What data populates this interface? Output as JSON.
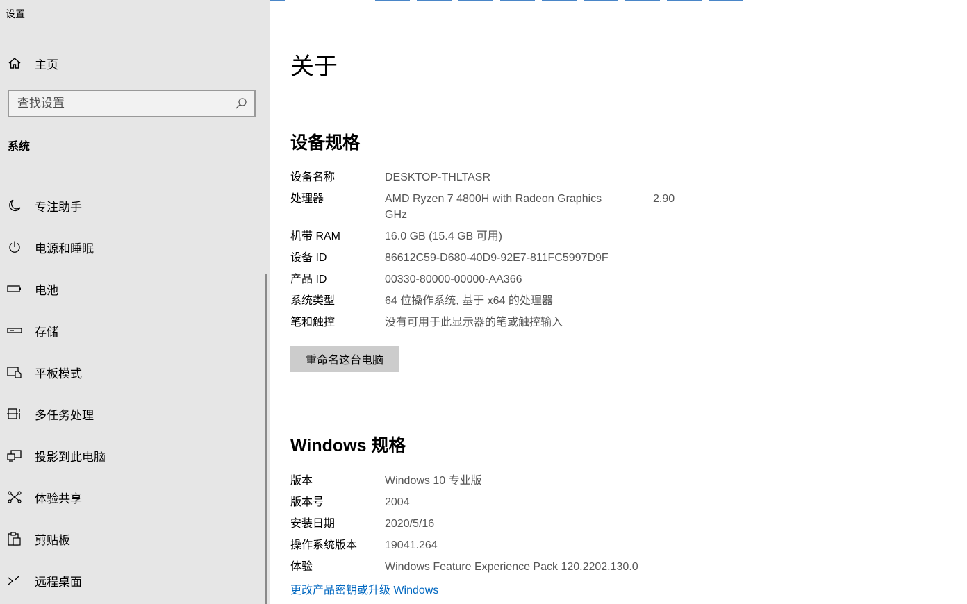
{
  "window": {
    "title": "设置"
  },
  "sidebar": {
    "home_label": "主页",
    "search_placeholder": "查找设置",
    "section_title": "系统",
    "items": [
      {
        "label": "专注助手",
        "icon": "moon-icon"
      },
      {
        "label": "电源和睡眠",
        "icon": "power-icon"
      },
      {
        "label": "电池",
        "icon": "battery-icon"
      },
      {
        "label": "存储",
        "icon": "storage-icon"
      },
      {
        "label": "平板模式",
        "icon": "tablet-mode-icon"
      },
      {
        "label": "多任务处理",
        "icon": "multitasking-icon"
      },
      {
        "label": "投影到此电脑",
        "icon": "project-icon"
      },
      {
        "label": "体验共享",
        "icon": "shared-experience-icon"
      },
      {
        "label": "剪贴板",
        "icon": "clipboard-icon"
      },
      {
        "label": "远程桌面",
        "icon": "remote-desktop-icon"
      }
    ]
  },
  "main": {
    "title": "关于",
    "device_specs": {
      "heading": "设备规格",
      "device_name_label": "设备名称",
      "device_name": "DESKTOP-THLTASR",
      "processor_label": "处理器",
      "processor": "AMD Ryzen 7 4800H with Radeon Graphics GHz",
      "processor_freq": "2.90",
      "ram_label": "机带 RAM",
      "ram": "16.0 GB (15.4 GB 可用)",
      "device_id_label": "设备 ID",
      "device_id": "86612C59-D680-40D9-92E7-811FC5997D9F",
      "product_id_label": "产品 ID",
      "product_id": "00330-80000-00000-AA366",
      "system_type_label": "系统类型",
      "system_type": "64 位操作系统, 基于 x64 的处理器",
      "pen_touch_label": "笔和触控",
      "pen_touch": "没有可用于此显示器的笔或触控输入",
      "rename_button": "重命名这台电脑"
    },
    "windows_specs": {
      "heading": "Windows 规格",
      "edition_label": "版本",
      "edition": "Windows 10 专业版",
      "version_label": "版本号",
      "version": "2004",
      "install_date_label": "安装日期",
      "install_date": "2020/5/16",
      "os_build_label": "操作系统版本",
      "os_build": "19041.264",
      "experience_label": "体验",
      "experience": "Windows Feature Experience Pack 120.2202.130.0",
      "upgrade_link": "更改产品密钥或升级 Windows"
    }
  },
  "colors": {
    "sidebar_bg": "#e6e6e6",
    "link": "#0067c0",
    "button_bg": "#cccccc",
    "value_text": "#555555"
  }
}
